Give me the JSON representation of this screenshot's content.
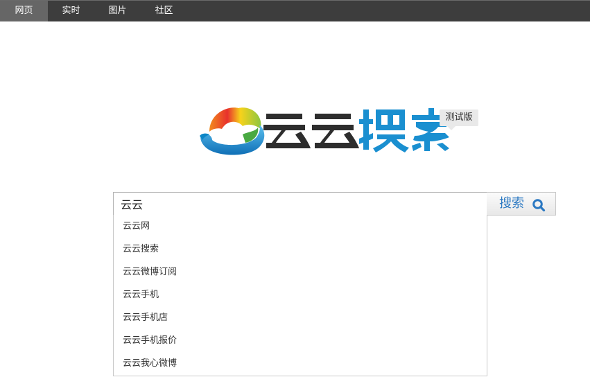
{
  "nav": {
    "tabs": [
      {
        "label": "网页",
        "active": true
      },
      {
        "label": "实时",
        "active": false
      },
      {
        "label": "图片",
        "active": false
      },
      {
        "label": "社区",
        "active": false
      }
    ]
  },
  "logo": {
    "text": "云云搜索",
    "badge": "测试版",
    "colors": {
      "dark": "#2d2d2d",
      "blue": "#1a8fd0"
    }
  },
  "search": {
    "value": "云云",
    "button_label": "搜索",
    "button_icon": "search-icon",
    "accent": "#2a78c2"
  },
  "suggestions": [
    "云云网",
    "云云搜索",
    "云云微博订阅",
    "云云手机",
    "云云手机店",
    "云云手机报价",
    "云云我心微博"
  ]
}
